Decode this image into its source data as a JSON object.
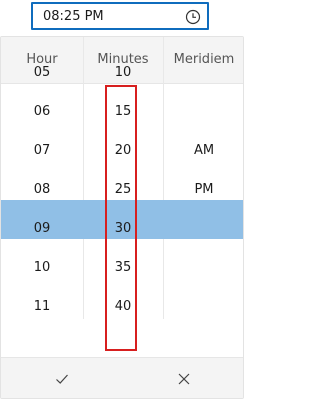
{
  "time_input": {
    "value": "08:25 PM",
    "icon": "clock-icon"
  },
  "picker": {
    "headers": {
      "hour": "Hour",
      "minutes": "Minutes",
      "meridiem": "Meridiem"
    },
    "hours": [
      "05",
      "06",
      "07",
      "08",
      "09",
      "10",
      "11"
    ],
    "minutes": [
      "10",
      "15",
      "20",
      "25",
      "30",
      "35",
      "40"
    ],
    "meridiem": [
      "AM",
      "PM"
    ],
    "selected": {
      "hour": "08",
      "minutes": "25",
      "meridiem": "PM"
    },
    "highlight_color": "#90bfe6",
    "annotation_color": "#d71f1f",
    "footer": {
      "accept_icon": "checkmark-icon",
      "cancel_icon": "close-icon"
    }
  }
}
